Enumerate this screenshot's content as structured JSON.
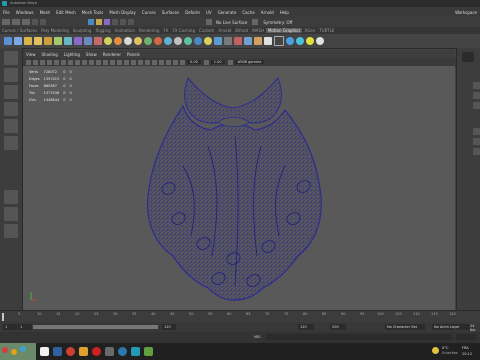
{
  "app": {
    "title": "Autodesk Maya",
    "right_title": "Workspace"
  },
  "menu": [
    "File",
    "Windows",
    "Mesh",
    "Edit Mesh",
    "Mesh Tools",
    "Mesh Display",
    "Curves",
    "Surfaces",
    "Deform",
    "UV",
    "Generate",
    "Cache",
    "Arnold",
    "Help"
  ],
  "statusline": {
    "no_live_surface": "No Live Surface",
    "symmetry": "Symmetry: Off"
  },
  "shelf_tabs": [
    "Curves / Surfaces",
    "Poly Modeling",
    "Sculpting",
    "Rigging",
    "Animation",
    "Rendering",
    "FX",
    "FX Caching",
    "Custom",
    "Arnold",
    "Bifrost",
    "MASH",
    "Motion Graphics",
    "XGen",
    "TURTLE"
  ],
  "shelf_active_index": 12,
  "viewport": {
    "menu": [
      "View",
      "Shading",
      "Lighting",
      "Show",
      "Renderer",
      "Panels"
    ],
    "camera_value": "0.00",
    "scale_value": "1.00",
    "colorspace": "sRGB gamma",
    "hud": [
      {
        "label": "Verts",
        "a": "728072",
        "b": "0",
        "c": "0"
      },
      {
        "label": "Edges",
        "a": "1397415",
        "b": "0",
        "c": "0"
      },
      {
        "label": "Faces",
        "a": "669387",
        "b": "0",
        "c": "0"
      },
      {
        "label": "Tris",
        "a": "1377438",
        "b": "0",
        "c": "0"
      },
      {
        "label": "UVs",
        "a": "1448844",
        "b": "0",
        "c": "0"
      }
    ],
    "mesh_color": "#2d2d8f",
    "background": "#595959"
  },
  "timeline": {
    "ticks": [
      "5",
      "10",
      "15",
      "20",
      "25",
      "30",
      "35",
      "40",
      "45",
      "50",
      "55",
      "60",
      "65",
      "70",
      "75",
      "80",
      "85",
      "90",
      "95",
      "100",
      "105",
      "110",
      "115",
      "120"
    ]
  },
  "range": {
    "start": "1",
    "end": "120",
    "anim_end": "120",
    "max": "200",
    "character_set": "No Character Set",
    "anim_layer": "No Anim Layer",
    "fps": "24 fps"
  },
  "command_line": {
    "lang": "MEL"
  },
  "taskbar": {
    "weather": "0°C",
    "weather_text": "Eclairées",
    "lang": "FRA",
    "time": "20:12"
  }
}
